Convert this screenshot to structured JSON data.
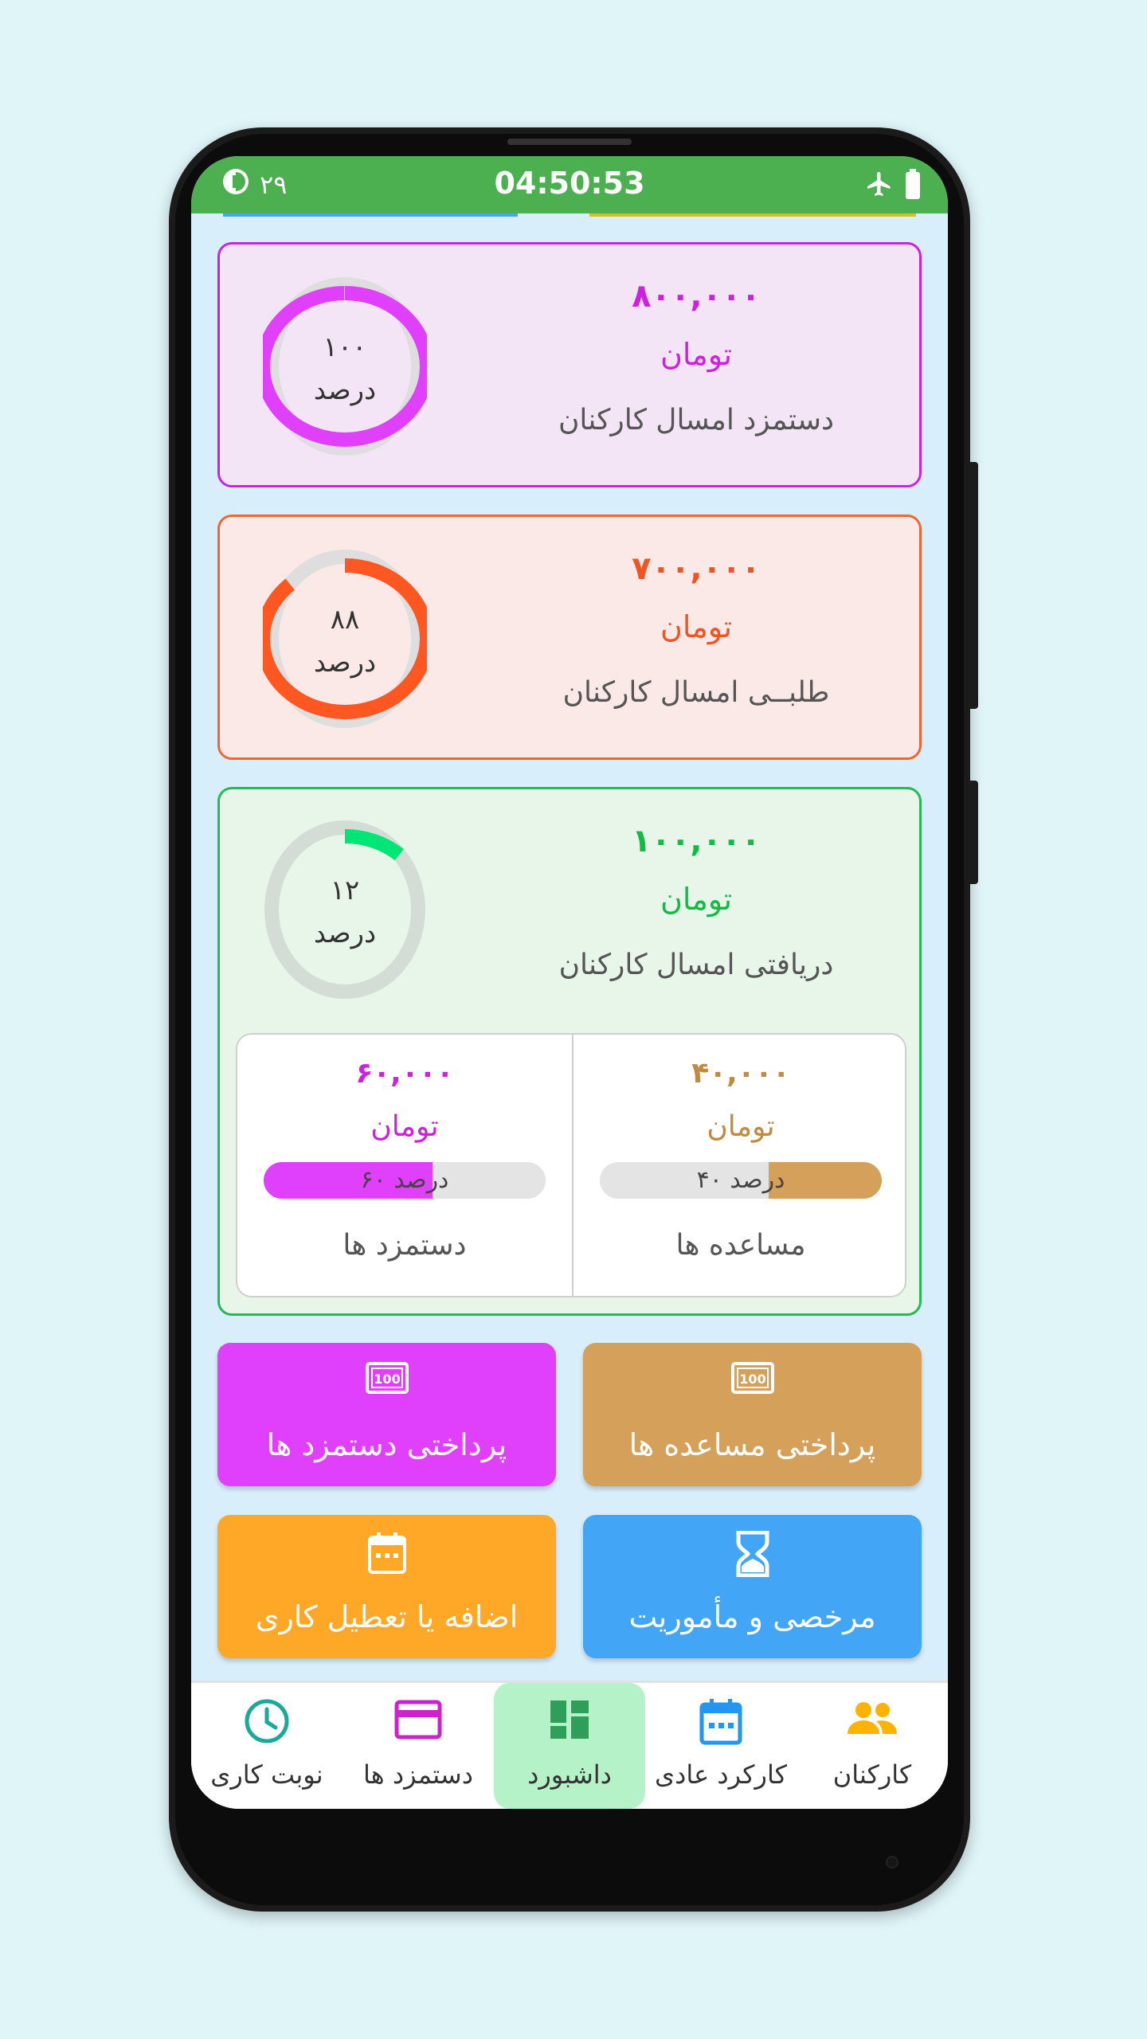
{
  "status": {
    "left_text": "۲۹",
    "time": "04:50:53"
  },
  "colors": {
    "magenta": "#e040fb",
    "orange": "#ff5722",
    "green": "#00c853",
    "tan": "#d4a05a",
    "amber": "#ffa726",
    "blue": "#42a5f5",
    "statusbar": "#4caf50"
  },
  "cards": [
    {
      "amount": "۸۰۰,۰۰۰",
      "unit": "تومان",
      "label": "دستمزد امسال کارکنان",
      "percent_number": "۱۰۰",
      "percent_word": "درصد",
      "progress": 1.0
    },
    {
      "amount": "۷۰۰,۰۰۰",
      "unit": "تومان",
      "label": "طلبــی امسال کارکنان",
      "percent_number": "۸۸",
      "percent_word": "درصد",
      "progress": 0.88
    },
    {
      "amount": "۱۰۰,۰۰۰",
      "unit": "تومان",
      "label": "دریافتی امسال کارکنان",
      "percent_number": "۱۲",
      "percent_word": "درصد",
      "progress": 0.12
    }
  ],
  "breakdown": {
    "advances": {
      "amount": "۴۰,۰۰۰",
      "unit": "تومان",
      "bar_text": "۴۰ درصد",
      "progress": 0.4,
      "label": "مساعده ها"
    },
    "wages": {
      "amount": "۶۰,۰۰۰",
      "unit": "تومان",
      "bar_text": "۶۰ درصد",
      "progress": 0.6,
      "label": "دستمزد ها"
    }
  },
  "actions": {
    "pay_advances": {
      "label": "پرداختی مساعده ها",
      "icon": "money-icon"
    },
    "pay_wages": {
      "label": "پرداختی دستمزد ها",
      "icon": "money-icon"
    },
    "leave_mission": {
      "label": "مرخصی و مأموریت",
      "icon": "hourglass-icon"
    },
    "overtime_holiday": {
      "label": "اضافه یا تعطیل کاری",
      "icon": "calendar-icon"
    }
  },
  "nav": {
    "employees": {
      "label": "کارکنان",
      "icon": "people-icon"
    },
    "normal_work": {
      "label": "کارکرد عادی",
      "icon": "calendar-icon"
    },
    "dashboard": {
      "label": "داشبورد",
      "icon": "dashboard-icon",
      "active": true
    },
    "wages": {
      "label": "دستمزد ها",
      "icon": "card-icon"
    },
    "shift": {
      "label": "نوبت کاری",
      "icon": "clock-icon"
    }
  }
}
